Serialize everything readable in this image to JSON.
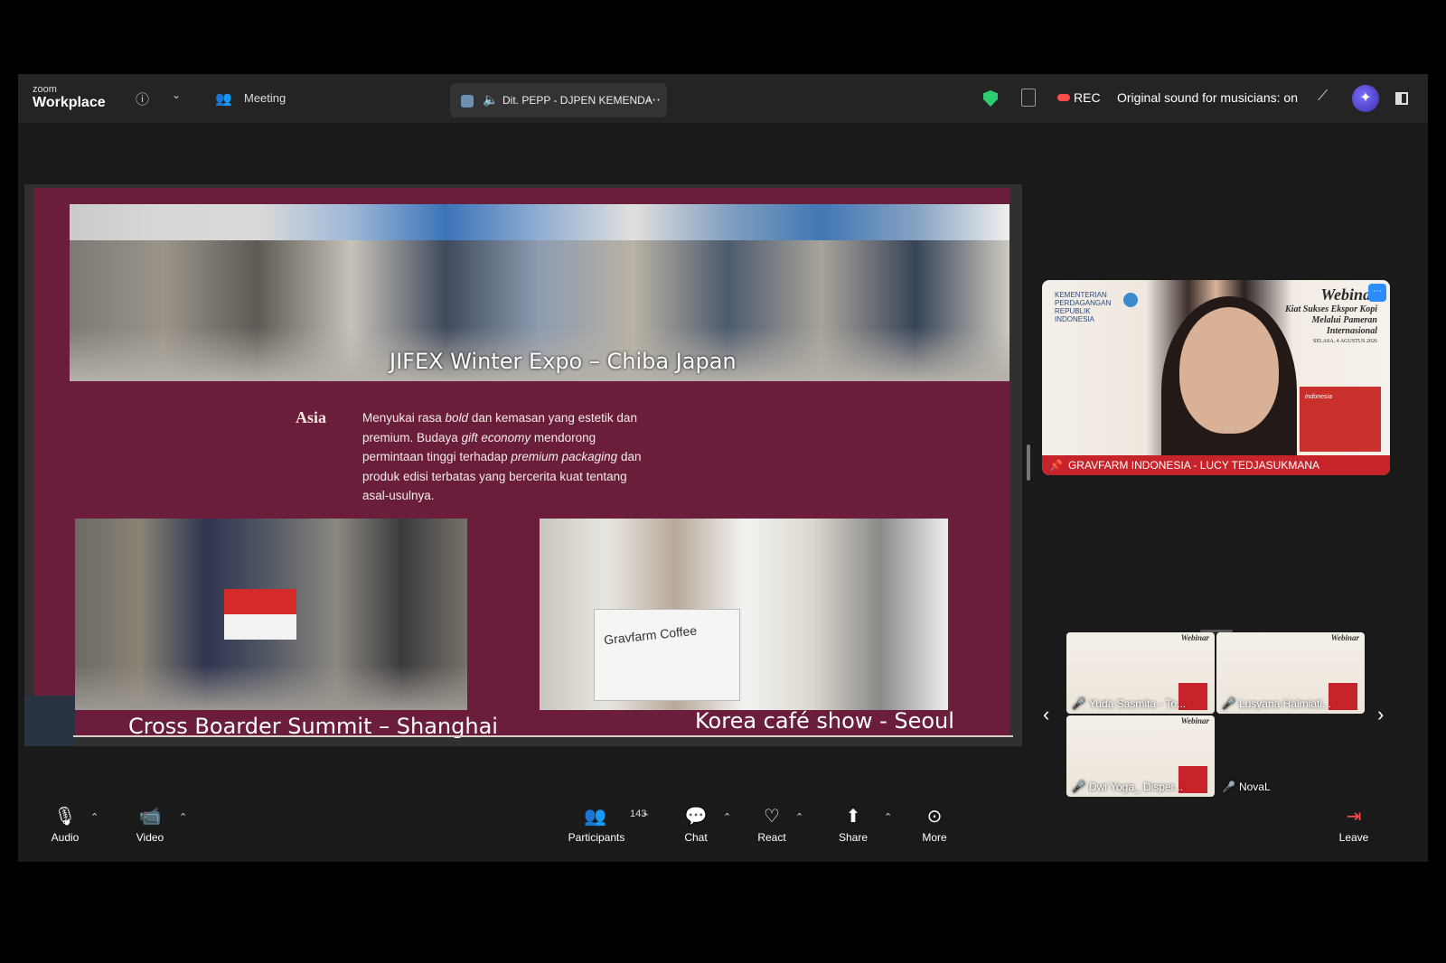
{
  "app": {
    "logo_small": "zoom",
    "logo_name": "Workplace",
    "meeting_label": "Meeting"
  },
  "share_tab": {
    "title": "Dit. PEPP - DJPEN KEMENDA"
  },
  "status": {
    "rec": "REC",
    "original_sound": "Original sound for musicians: on"
  },
  "slide": {
    "caption_top": "JIFEX Winter Expo – Chiba Japan",
    "caption_left": "Cross Boarder Summit – Shanghai",
    "caption_right": "Korea café show - Seoul",
    "region": "Asia",
    "body_parts": [
      "Menyukai rasa ",
      "bold",
      " dan kemasan yang estetik dan premium. Budaya ",
      "gift economy",
      " mendorong permintaan tinggi terhadap ",
      "premium packaging",
      " dan produk edisi terbatas yang bercerita kuat tentang asal-usulnya."
    ],
    "booth_brand": "Gravfarm Coffee"
  },
  "speaker": {
    "name": "GRAVFARM INDONESIA - LUCY TEDJASUKMANA",
    "background": {
      "org": "KEMENTERIAN PERDAGANGAN REPUBLIK INDONESIA",
      "title": "Webinar",
      "subtitle_lines": [
        "Kiat Sukses Ekspor Kopi",
        "Melalui Pameran",
        "Internasional"
      ],
      "date": "SELASA, 4 AGUSTUS 2026",
      "booth_label": "indonesia"
    }
  },
  "participants_tiles": [
    {
      "name": "Yuda Sasmita - To..."
    },
    {
      "name": "Lusyana Halmiati..."
    },
    {
      "name": "Dwi Yoga_ Disper..."
    },
    {
      "name": "NovaL"
    }
  ],
  "tile_mini_title": "Webinar",
  "toolbar": {
    "audio": "Audio",
    "video": "Video",
    "participants": "Participants",
    "participants_count": "143",
    "chat": "Chat",
    "react": "React",
    "share": "Share",
    "more": "More",
    "leave": "Leave"
  },
  "colors": {
    "slide_bg": "#6b1e3c",
    "accent_blue": "#2d8cff",
    "shield": "#2ecc71",
    "mute_red": "#ff4d4d"
  }
}
